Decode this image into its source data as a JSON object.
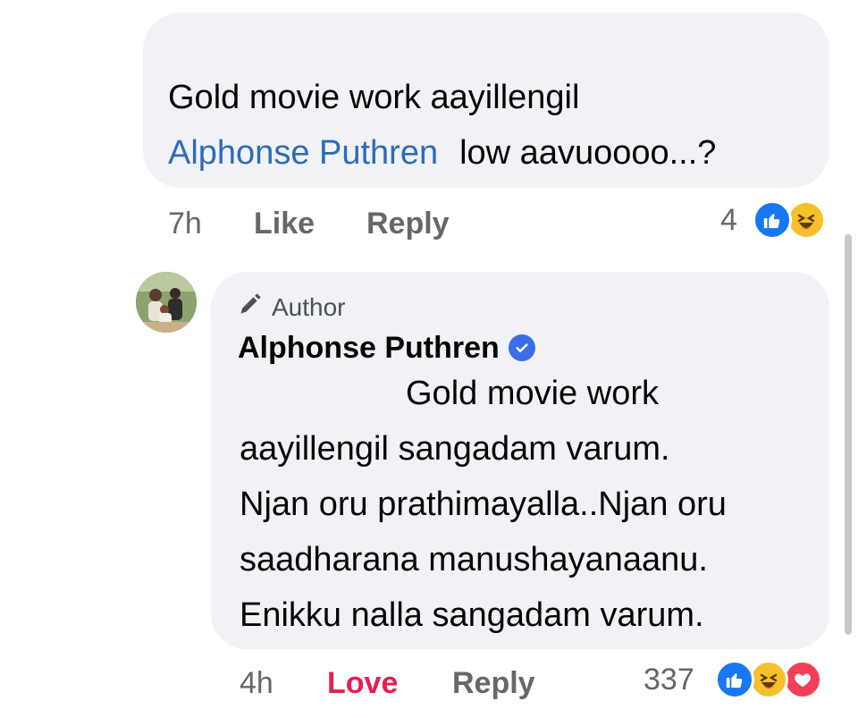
{
  "top_comment": {
    "text_line1": "Gold movie work aayillengil",
    "mention": "Alphonse Puthren",
    "text_line2": "low aavuoooo...?",
    "time": "7h",
    "like_label": "Like",
    "reply_label": "Reply",
    "reaction_count": "4",
    "reactions": [
      "like-icon",
      "haha-icon"
    ]
  },
  "reply_comment": {
    "badge": "Author",
    "author": "Alphonse Puthren",
    "verified": true,
    "lines": [
      "Gold movie work",
      "aayillengil sangadam varum.",
      "Njan oru prathimayalla..Njan oru",
      "saadharana manushayanaanu.",
      "Enikku nalla sangadam varum."
    ],
    "time": "4h",
    "love_label": "Love",
    "reply_label": "Reply",
    "reaction_count": "337",
    "reactions": [
      "like-icon",
      "haha-icon",
      "love-icon"
    ]
  },
  "colors": {
    "bubble": "#f0f2f5",
    "mention": "#2b6cb8",
    "meta": "#65676b",
    "love": "#e41e52",
    "like": "#1877f2",
    "verified": "#3a6ee8"
  }
}
